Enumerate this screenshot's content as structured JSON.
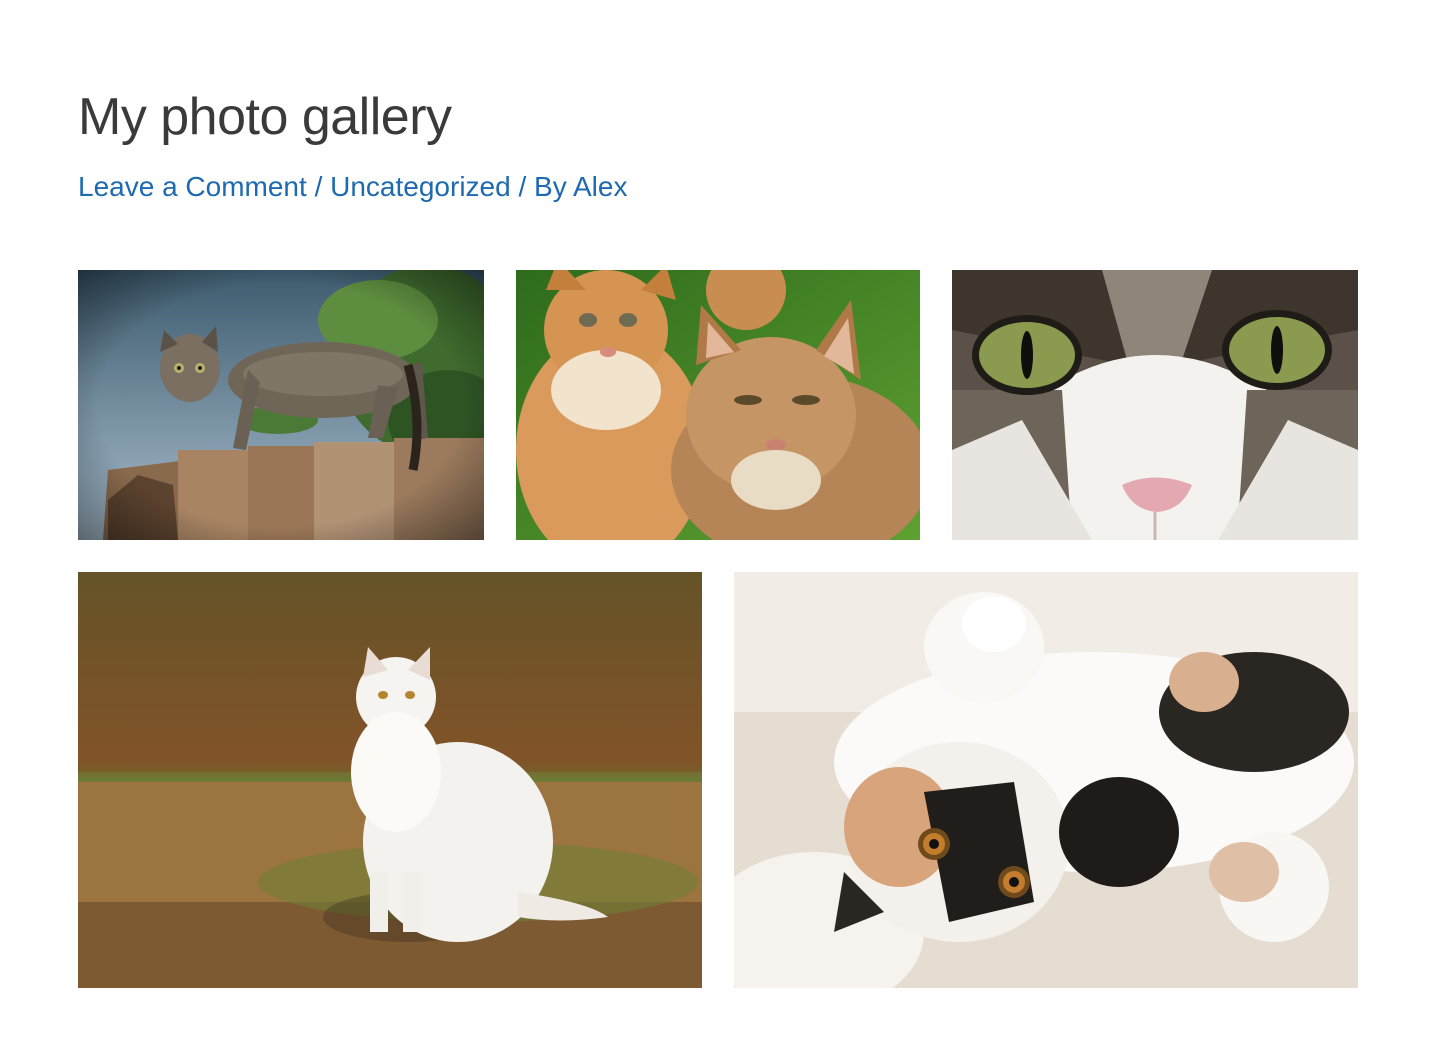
{
  "post": {
    "title": "My photo gallery",
    "meta": {
      "comment_link": "Leave a Comment",
      "separator": " / ",
      "category_link": "Uncategorized",
      "author_prefix": "By ",
      "author_link": "Alex"
    }
  },
  "colors": {
    "title": "#3a3a3a",
    "link": "#1e6ab0",
    "background": "#ffffff"
  },
  "gallery": {
    "images": [
      {
        "subject": "tabby cat on wooden fence"
      },
      {
        "subject": "two orange kittens"
      },
      {
        "subject": "cat face close-up with green eyes"
      },
      {
        "subject": "white fluffy cat sitting on grass"
      },
      {
        "subject": "calico cat lying upside down"
      }
    ]
  }
}
